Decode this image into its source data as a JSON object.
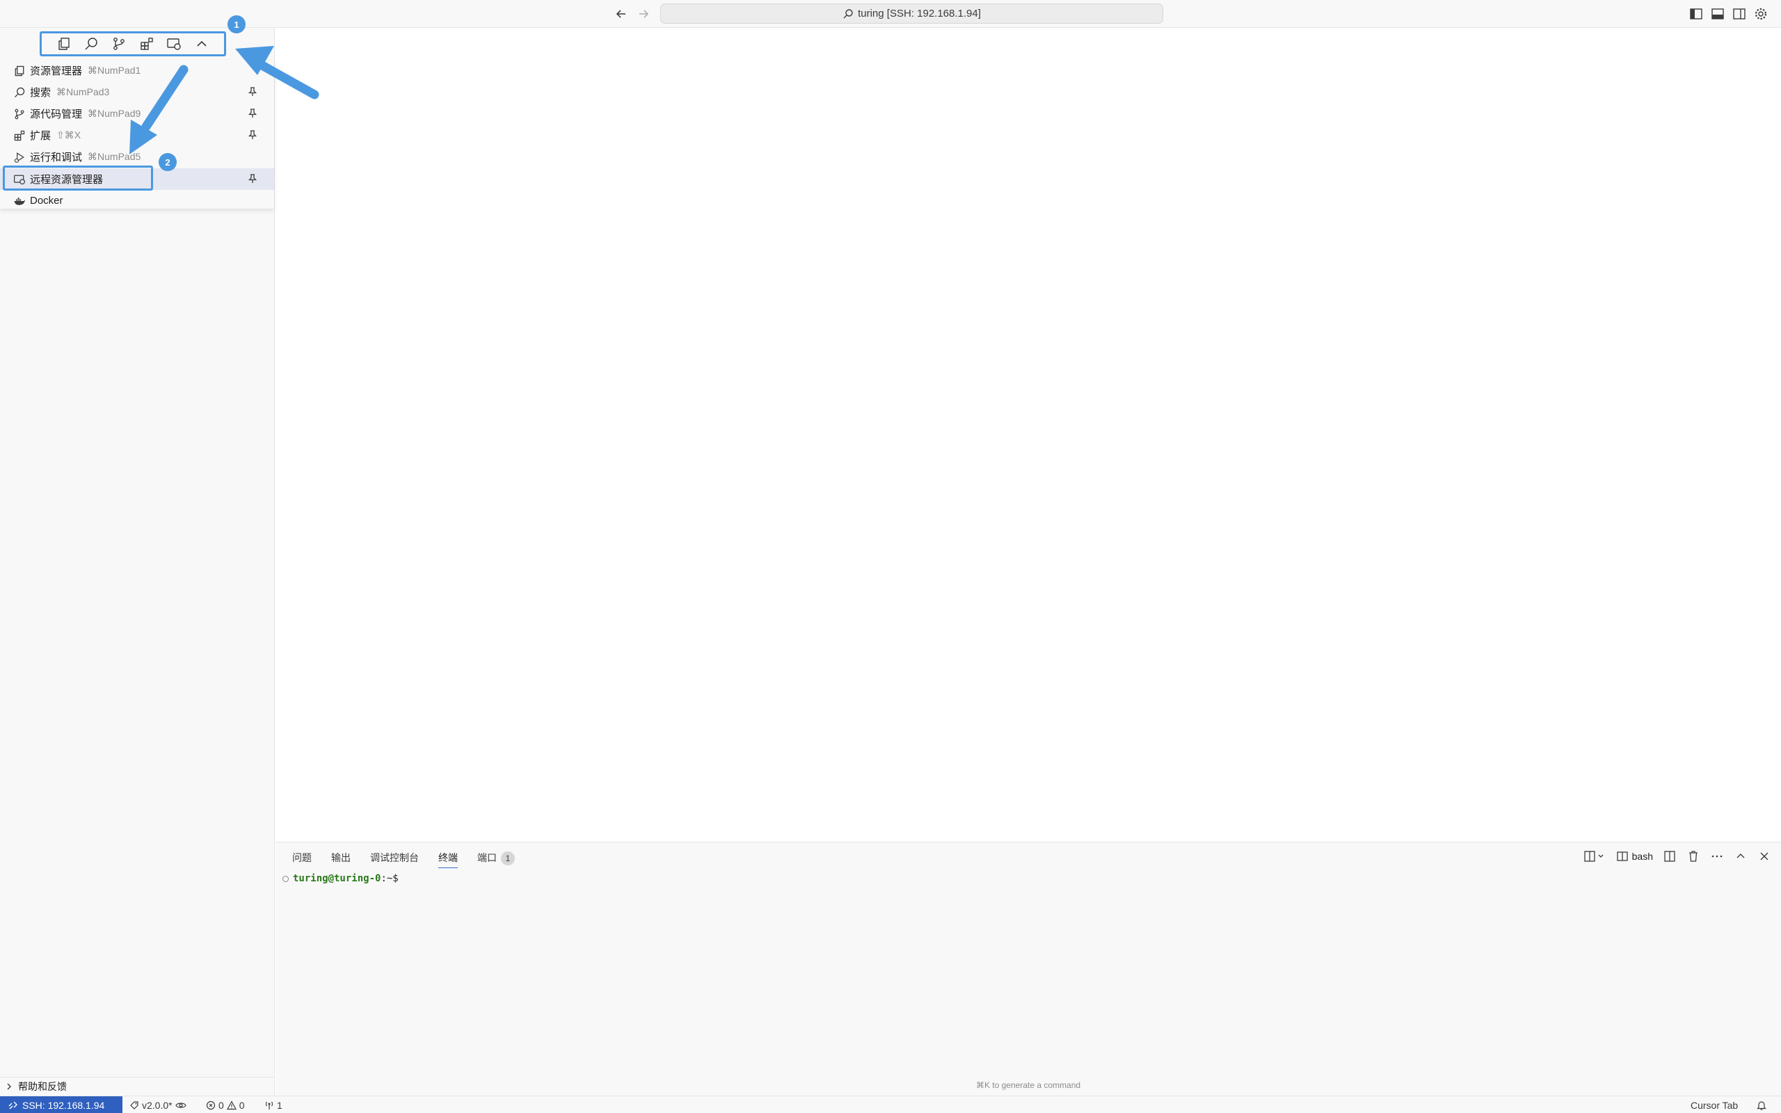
{
  "titlebar": {
    "command_center": "turing [SSH: 192.168.1.94]"
  },
  "callouts": {
    "badge_1": "1",
    "badge_2": "2"
  },
  "view_menu": {
    "items": [
      {
        "label": "资源管理器",
        "shortcut": "⌘NumPad1",
        "icon": "files-icon"
      },
      {
        "label": "搜索",
        "shortcut": "⌘NumPad3",
        "icon": "search-icon"
      },
      {
        "label": "源代码管理",
        "shortcut": "⌘NumPad9",
        "icon": "source-control-icon"
      },
      {
        "label": "扩展",
        "shortcut": "⇧⌘X",
        "icon": "extensions-icon"
      },
      {
        "label": "运行和调试",
        "shortcut": "⌘NumPad5",
        "icon": "run-debug-icon"
      },
      {
        "label": "远程资源管理器",
        "shortcut": "",
        "icon": "remote-explorer-icon",
        "selected": true
      },
      {
        "label": "Docker",
        "shortcut": "",
        "icon": "docker-icon"
      }
    ]
  },
  "sidebar": {
    "help_section": "帮助和反馈"
  },
  "panel": {
    "tabs": [
      {
        "label": "问题"
      },
      {
        "label": "输出"
      },
      {
        "label": "调试控制台"
      },
      {
        "label": "终端",
        "active": true
      },
      {
        "label": "端口",
        "badge": "1"
      }
    ],
    "terminal_profile": "bash",
    "terminal": {
      "user_host": "turing@turing-0",
      "path": ":~$"
    },
    "hint": "⌘K to generate a command"
  },
  "statusbar": {
    "remote": "SSH: 192.168.1.94",
    "version": "v2.0.0*",
    "errors": "0",
    "warnings": "0",
    "ports": "1",
    "cursor_tab": "Cursor Tab"
  },
  "colors": {
    "accent": "#4a98e0",
    "remote_bg": "#2f5fbf",
    "selected_bg": "#e4e6f1",
    "terminal_user": "#2a7a1a"
  }
}
